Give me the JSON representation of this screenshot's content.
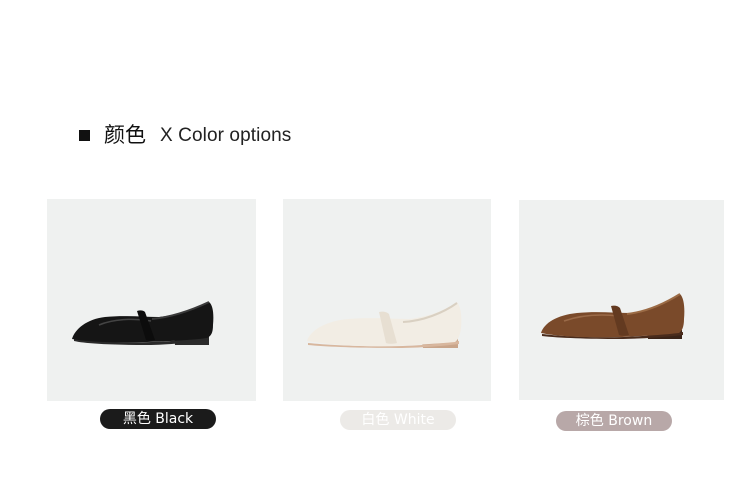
{
  "header": {
    "title_cn": "颜色",
    "title_en": "X Color options",
    "bullet_icon": "square-bullet-icon"
  },
  "colors": {
    "card_bg": "#eff1f0"
  },
  "products": [
    {
      "label": "黑色 Black",
      "pill_bg": "#1b1b1b",
      "pill_text": "#ffffff",
      "shoe_color": "#151515"
    },
    {
      "label": "白色 White",
      "pill_bg": "#eceae7",
      "pill_text": "#ffffff",
      "shoe_color": "#f0ebe1"
    },
    {
      "label": "棕色 Brown",
      "pill_bg": "#b8a8a8",
      "pill_text": "#ffffff",
      "shoe_color": "#7a4a2a"
    }
  ]
}
